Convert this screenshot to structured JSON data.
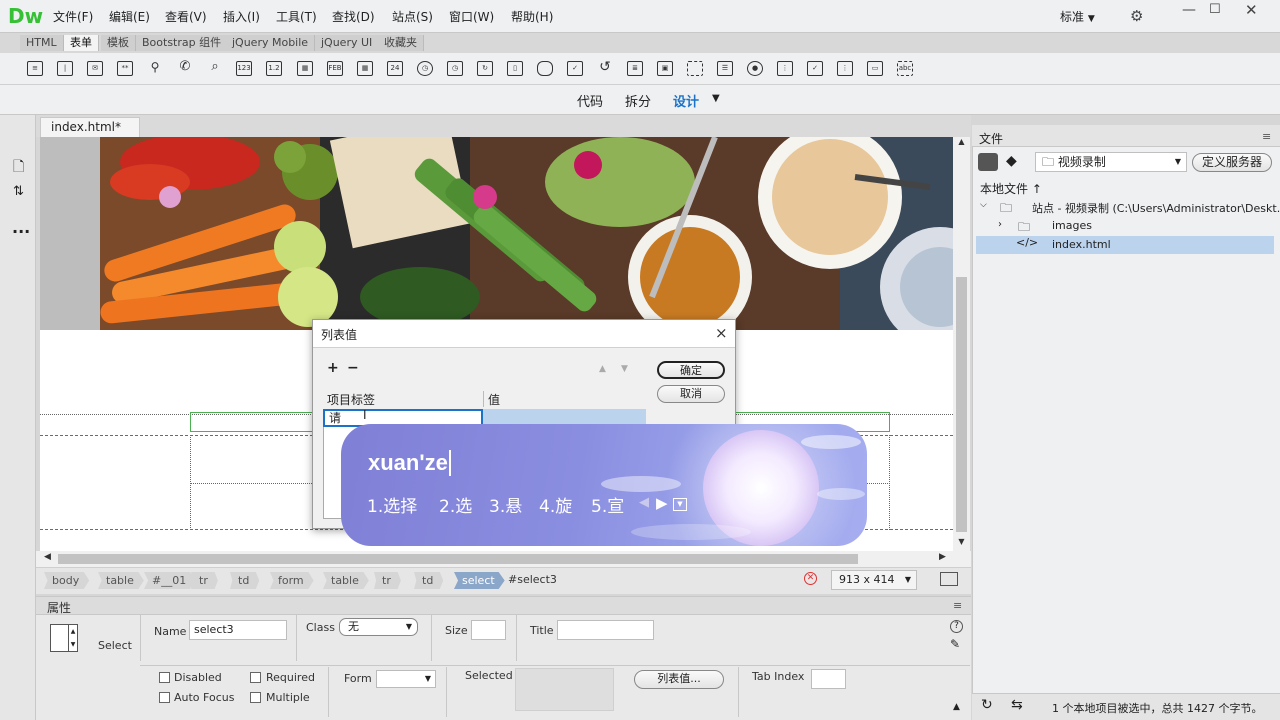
{
  "app": {
    "logo": "Dw",
    "workspace": "标准"
  },
  "menu": [
    "文件(F)",
    "编辑(E)",
    "查看(V)",
    "插入(I)",
    "工具(T)",
    "查找(D)",
    "站点(S)",
    "窗口(W)",
    "帮助(H)"
  ],
  "insert_tabs": [
    "HTML",
    "表单",
    "模板",
    "Bootstrap 组件",
    "jQuery Mobile",
    "jQuery UI",
    "收藏夹"
  ],
  "view_modes": {
    "code": "代码",
    "split": "拆分",
    "design": "设计"
  },
  "document": {
    "tab_label": "index.html*",
    "close": "×"
  },
  "tag_selector": [
    "body",
    "table",
    "#__01",
    "tr",
    "td",
    "form",
    "table",
    "tr",
    "td",
    "select"
  ],
  "tag_id": "#select3",
  "window_size": "913 x 414",
  "properties": {
    "panel_title": "属性",
    "element_type": "Select",
    "name_label": "Name",
    "name_value": "select3",
    "class_label": "Class",
    "class_value": "无",
    "size_label": "Size",
    "title_label": "Title",
    "disabled": "Disabled",
    "required": "Required",
    "auto_focus": "Auto Focus",
    "multiple": "Multiple",
    "form_label": "Form",
    "selected_label": "Selected",
    "list_values_button": "列表值...",
    "tab_index_label": "Tab Index"
  },
  "files_panel": {
    "title": "文件",
    "site_select": "视频录制",
    "define_server": "定义服务器",
    "local_files": "本地文件 ↑",
    "site_root": "站点 - 视频录制 (C:\\Users\\Administrator\\Deskt...",
    "items": [
      "images",
      "index.html"
    ],
    "status": "1 个本地项目被选中，总共 1427 个字节。"
  },
  "dialog": {
    "title": "列表值",
    "close": "×",
    "add": "+",
    "remove": "−",
    "col_label": "项目标签",
    "col_value": "值",
    "input_text": "请",
    "ok": "确定",
    "cancel": "取消"
  },
  "ime": {
    "composition": "xuan'ze",
    "candidates": [
      "1.选择",
      "2.选",
      "3.悬",
      "4.旋",
      "5.宣"
    ]
  },
  "colors": {
    "logo": "#35c035",
    "accent": "#1a73c8",
    "selection": "#bcd3ee"
  }
}
